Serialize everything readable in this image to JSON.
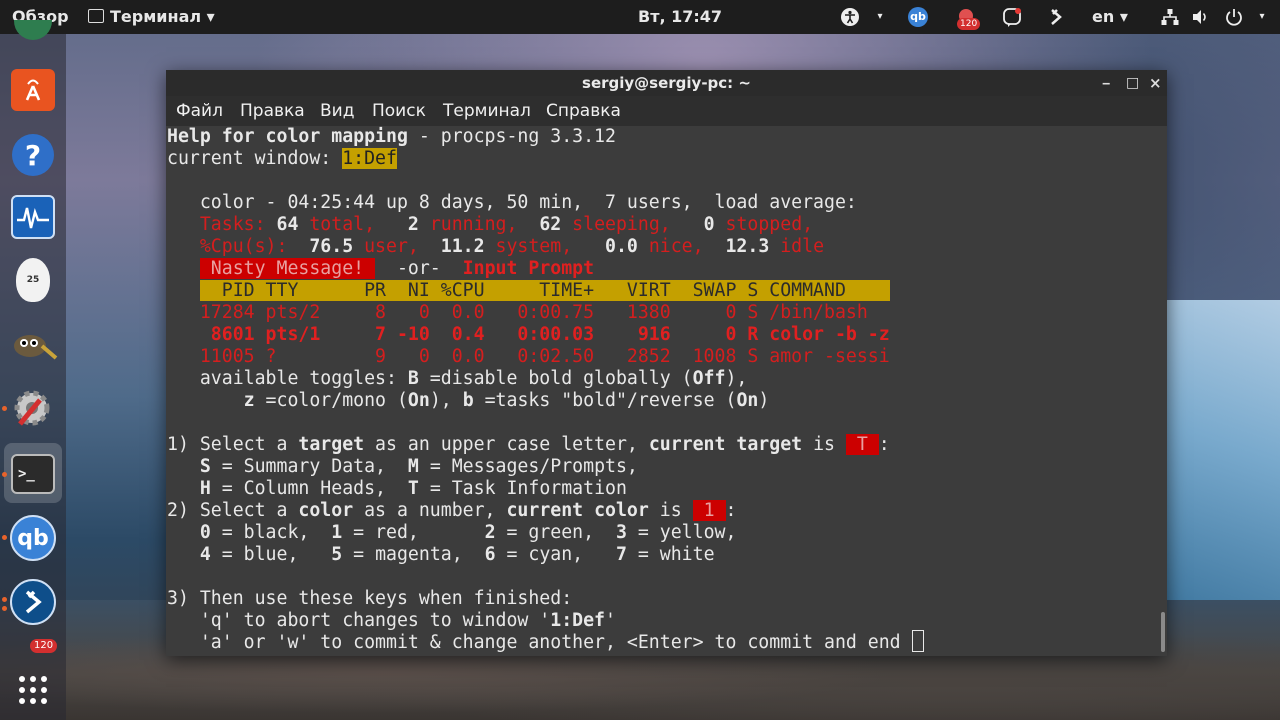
{
  "top_panel": {
    "activities": "Обзор",
    "app_menu": "Терминал ▾",
    "clock": "Вт, 17:47",
    "accessibility_icon": "accessibility-icon",
    "qb_tray": "qb",
    "qb_badge": "120",
    "lang": "en ▾",
    "network_icon": "network-icon",
    "volume_icon": "volume-icon",
    "power_icon": "power-icon"
  },
  "dock": {
    "badge": "120",
    "icons": [
      "ubuntu-software-icon",
      "help-icon",
      "system-monitor-icon",
      "egg-timer-icon",
      "gimp-icon",
      "settings-icon",
      "terminal-icon",
      "qbittorrent-icon",
      "kodi-icon",
      "app-grid-icon"
    ],
    "egg_label": "25",
    "qb_label": "qb"
  },
  "window": {
    "title": "sergiy@sergiy-pc: ~",
    "minimize": "‒",
    "maximize": "□",
    "close": "×",
    "menu": [
      "Файл",
      "Правка",
      "Вид",
      "Поиск",
      "Терминал",
      "Справка"
    ]
  },
  "terminal": {
    "l1_help": "Help for color mapping",
    "l1_rest": " - procps-ng 3.3.12",
    "l2_label": "current window: ",
    "l2_win": "1:Def",
    "l3": "   color - 04:25:44 up 8 days, 50 min,  7 users,  load average:",
    "tasks_label": "   Tasks: ",
    "tasks_total_n": "64",
    "tasks_total_w": " total, ",
    "tasks_run_n": "  2",
    "tasks_run_w": " running, ",
    "tasks_sleep_n": " 62",
    "tasks_sleep_w": " sleeping, ",
    "tasks_stop_n": "  0",
    "tasks_stop_w": " stopped,",
    "cpu_label": "   %Cpu(s): ",
    "cpu_us_n": " 76.5",
    "cpu_us_w": " user, ",
    "cpu_sy_n": " 11.2",
    "cpu_sy_w": " system, ",
    "cpu_ni_n": "  0.0",
    "cpu_ni_w": " nice, ",
    "cpu_id_n": " 12.3",
    "cpu_id_w": " idle",
    "nasty": " Nasty Message! ",
    "or": "  -or-  ",
    "input_prompt": "Input Prompt",
    "header": "  PID TTY      PR  NI %CPU     TIME+   VIRT  SWAP S COMMAND    ",
    "row1": "17284 pts/2     8   0  0.0   0:00.75   1380     0 S /bin/bash",
    "row2": "  8601 pts/1     7 -10  0.4   0:00.03    916     0 R color -b -z",
    "row3": "11005 ?         9   0  0.0   0:02.50   2852  1008 S amor -sessi",
    "toggles_a": "   available toggles: ",
    "toggles_B": "B",
    "toggles_b1": " =disable bold globally (",
    "toggles_off": "Off",
    "toggles_b2": "),",
    "toggles2_pre": "       ",
    "toggles2_z": "z",
    "toggles2_a": " =color/mono (",
    "toggles2_on1": "On",
    "toggles2_b": "), ",
    "toggles2_bb": "b",
    "toggles2_c": " =tasks \"bold\"/reverse (",
    "toggles2_on2": "On",
    "toggles2_d": ")",
    "s1_a": "1) Select a ",
    "s1_target": "target",
    "s1_b": " as an upper case letter, ",
    "s1_ct": "current target",
    "s1_c": " is ",
    "s1_val": " T ",
    "s1_d": ":",
    "s1_l2_S": "S",
    "s1_l2_a": " = Summary Data,  ",
    "s1_l2_M": "M",
    "s1_l2_b": " = Messages/Prompts,",
    "s1_l3_H": "H",
    "s1_l3_a": " = Column Heads,  ",
    "s1_l3_T": "T",
    "s1_l3_b": " = Task Information",
    "s2_a": "2) Select a ",
    "s2_color": "color",
    "s2_b": " as a number, ",
    "s2_cc": "current color",
    "s2_c": " is ",
    "s2_val": " 1 ",
    "s2_d": ":",
    "c0": "0",
    "c0t": " = black,  ",
    "c1": "1",
    "c1t": " = red,      ",
    "c2": "2",
    "c2t": " = green,  ",
    "c3": "3",
    "c3t": " = yellow,",
    "c4": "4",
    "c4t": " = blue,   ",
    "c5": "5",
    "c5t": " = magenta,  ",
    "c6": "6",
    "c6t": " = cyan,   ",
    "c7": "7",
    "c7t": " = white",
    "s3": "3) Then use these keys when finished:",
    "s3_q_a": "   'q' to abort changes to window '",
    "s3_q_w": "1:Def",
    "s3_q_b": "'",
    "s3_a": "   'a' or 'w' to commit & change another, <Enter> to commit and end "
  }
}
